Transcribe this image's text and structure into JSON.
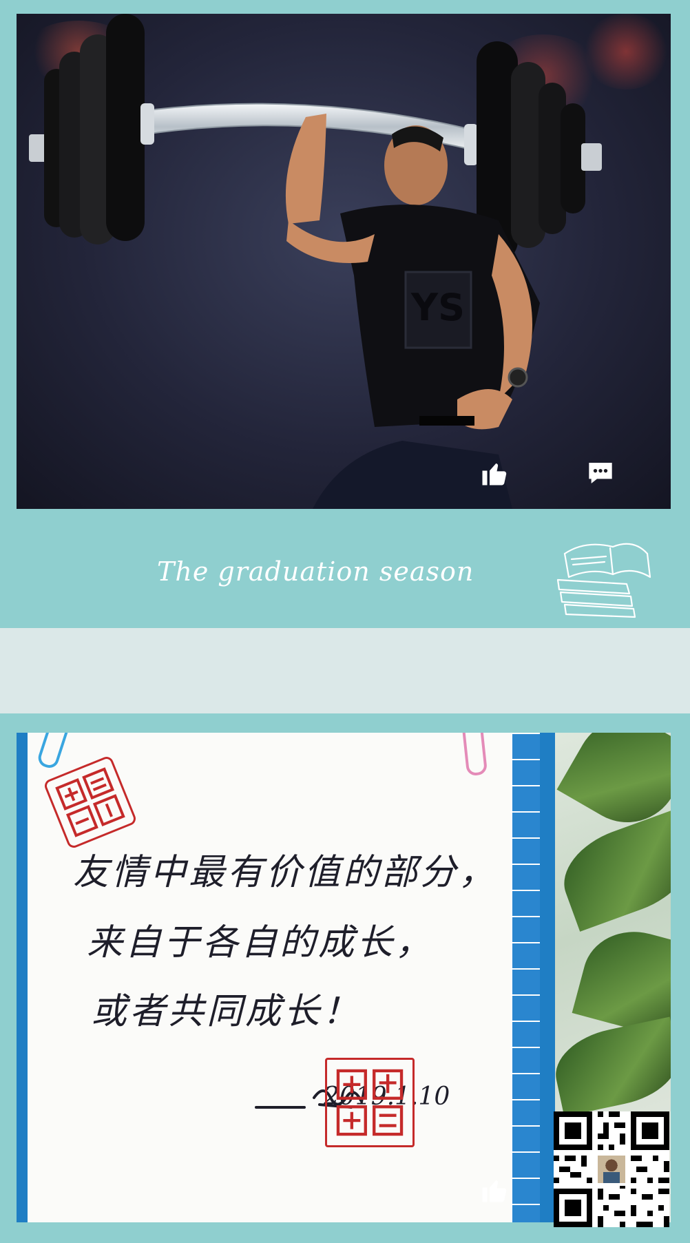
{
  "post1": {
    "caption": "The graduation season",
    "shirt_logo": "YS",
    "icons": {
      "like": "thumbs-up-icon",
      "comment": "comment-icon",
      "book": "book-sketch-icon"
    }
  },
  "post2": {
    "note_lines": [
      "友情中最有价值的部分，",
      "来自于各自的成长，",
      "或者共同成长！"
    ],
    "signature_date": "2019.1.10",
    "icons": {
      "like": "thumbs-up-icon",
      "qr": "qr-code-icon"
    }
  },
  "colors": {
    "background": "#8fcfcf",
    "separator": "#dbe8e8",
    "seal_red": "#c52a2a",
    "grid_blue": "#2a86cf"
  }
}
